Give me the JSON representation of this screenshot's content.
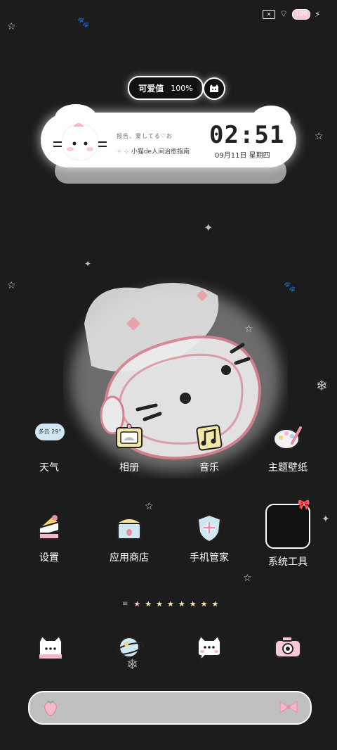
{
  "status_bar": {
    "battery": "100",
    "wifi_badge": "6"
  },
  "badge": {
    "label": "可爱值",
    "percent": "100%"
  },
  "widget": {
    "motto_line1": "报告、爱してる♡お",
    "motto_line2_prefix": "✧ ⊹",
    "motto_line2": "小猫de人间治愈指南",
    "time": "02:51",
    "date": "09月11日 星期四"
  },
  "weather": {
    "text": "多云 29°"
  },
  "apps_row1": [
    {
      "label": "天气",
      "icon": "cloud-weather-icon"
    },
    {
      "label": "相册",
      "icon": "photo-album-icon"
    },
    {
      "label": "音乐",
      "icon": "music-note-icon"
    },
    {
      "label": "主题壁纸",
      "icon": "palette-icon"
    }
  ],
  "apps_row2": [
    {
      "label": "设置",
      "icon": "cake-settings-icon"
    },
    {
      "label": "应用商店",
      "icon": "store-icon"
    },
    {
      "label": "手机管家",
      "icon": "shield-icon"
    },
    {
      "label": "系统工具",
      "icon": "folder-icon"
    }
  ],
  "page_indicator": {
    "pages": 8,
    "active": 1
  },
  "bottom_apps": [
    {
      "icon": "cat-phone-icon"
    },
    {
      "icon": "planet-browser-icon"
    },
    {
      "icon": "cat-message-icon"
    },
    {
      "icon": "camera-icon"
    }
  ],
  "colors": {
    "background": "#1c1c1c",
    "accent_pink": "#f3b7c8",
    "star_yellow": "#f6e7a4"
  }
}
